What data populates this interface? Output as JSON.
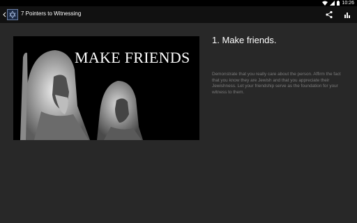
{
  "status": {
    "time": "10:26"
  },
  "toolbar": {
    "title": "7 Pointers to Witnessing"
  },
  "hero": {
    "text": "MAKE FRIENDS"
  },
  "content": {
    "heading": "1. Make friends.",
    "body": "Demonstrate that you really care about the person. Affirm the fact that you know they are Jewish and that you appreciate their Jewishness. Let your friendship serve as the foundation for your witness to them."
  },
  "colors": {
    "background": "#282828",
    "actionbar": "#111111",
    "body_text": "#7c7c7c"
  }
}
